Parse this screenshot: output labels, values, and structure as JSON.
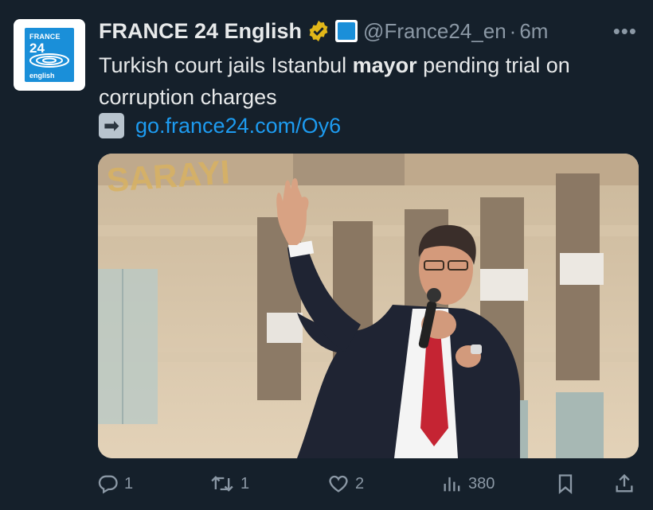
{
  "tweet": {
    "avatar": {
      "brand": "FRANCE",
      "number": "24",
      "language": "english"
    },
    "display_name": "FRANCE 24 English",
    "handle": "@France24_en",
    "separator": "·",
    "time": "6m",
    "more_label": "•••",
    "text_before": "Turkish court jails Istanbul ",
    "text_bold": "mayor",
    "text_after": " pending trial on corruption charges",
    "link_emoji": "➡",
    "link_text": "go.france24.com/Oy6",
    "media": {
      "sign_text": "SARAYI"
    },
    "actions": {
      "replies": "1",
      "reposts": "1",
      "likes": "2",
      "views": "380"
    }
  },
  "colors": {
    "background": "#15202b",
    "text": "#e7e9ea",
    "secondary": "#8b98a5",
    "link": "#1d9bf0",
    "verified_gold": "#e2b719",
    "brand_blue": "#1a8fd9"
  }
}
